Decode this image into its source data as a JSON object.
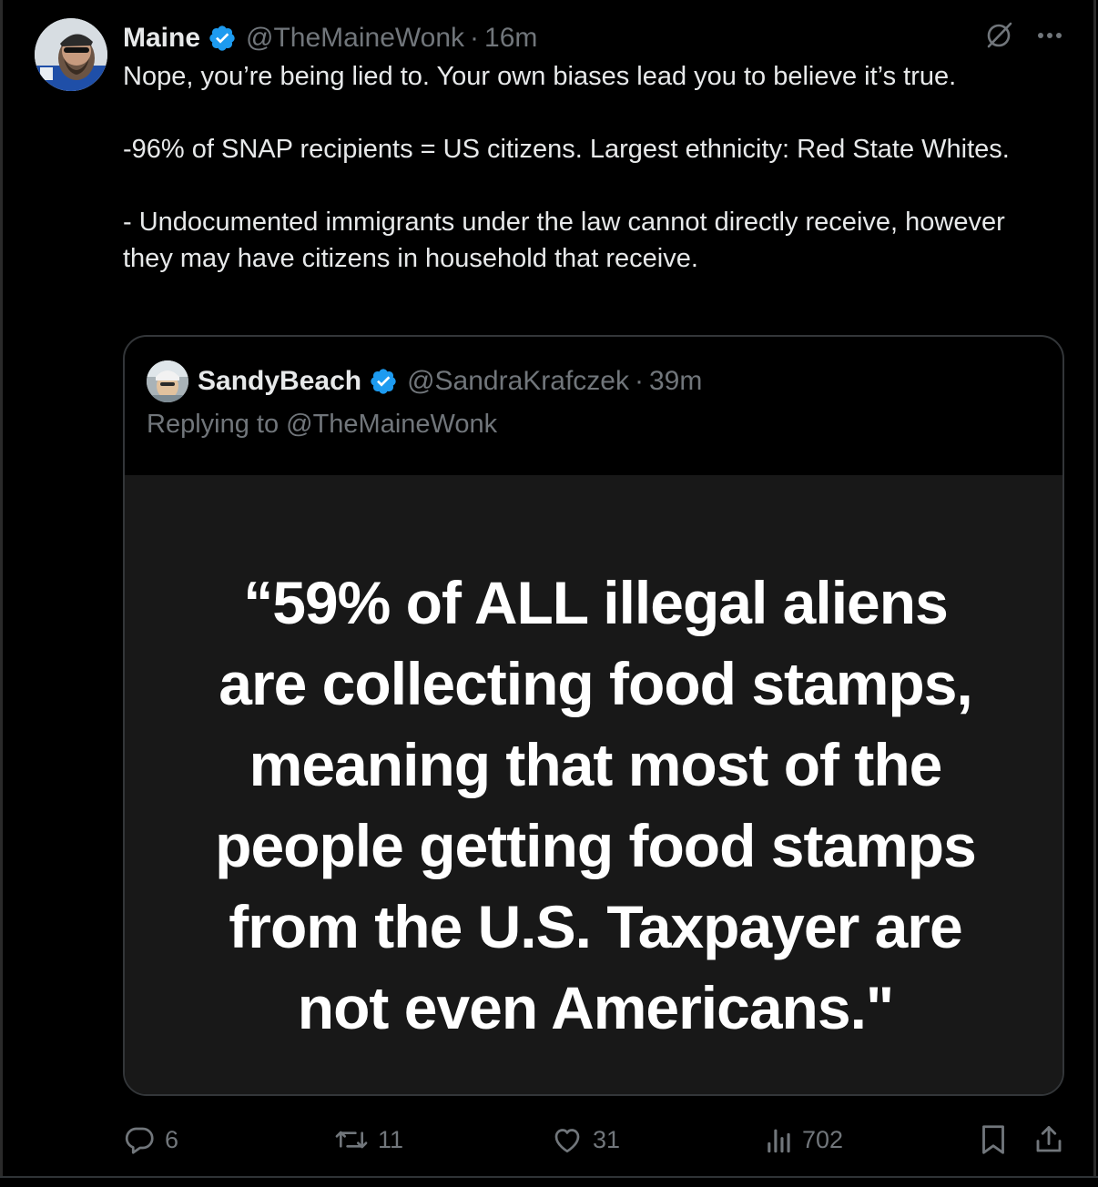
{
  "post": {
    "author_name": "Maine",
    "author_handle": "@TheMaineWonk",
    "separator": "·",
    "time": "16m",
    "paragraphs": [
      "Nope, you’re being lied to. Your own biases lead you to believe it’s true.",
      "-96% of SNAP recipients = US  citizens. Largest ethnicity: Red State Whites.",
      "- Undocumented immigrants under the law cannot directly receive, however they may have citizens in household that receive."
    ]
  },
  "quoted": {
    "author_name": "SandyBeach",
    "author_handle": "@SandraKrafczek",
    "separator": "·",
    "time": "39m",
    "replying_to": "Replying to @TheMaineWonk",
    "image_lines": [
      "“59% of ALL illegal aliens",
      "are collecting food stamps,",
      "meaning that most of the",
      "people getting food stamps",
      "from the U.S. Taxpayer are",
      "not even Americans.\""
    ]
  },
  "actions": {
    "replies": "6",
    "reposts": "11",
    "likes": "31",
    "views": "702"
  },
  "icons": {
    "verified": "verified-badge-icon",
    "grok": "grok-icon",
    "more": "more-icon",
    "reply": "reply-icon",
    "repost": "repost-icon",
    "like": "heart-icon",
    "views": "views-icon",
    "bookmark": "bookmark-icon",
    "share": "share-icon"
  },
  "colors": {
    "background": "#000000",
    "text_primary": "#e7e9ea",
    "text_secondary": "#71767b",
    "verified_blue": "#1d9bf0",
    "image_background": "#181818"
  }
}
